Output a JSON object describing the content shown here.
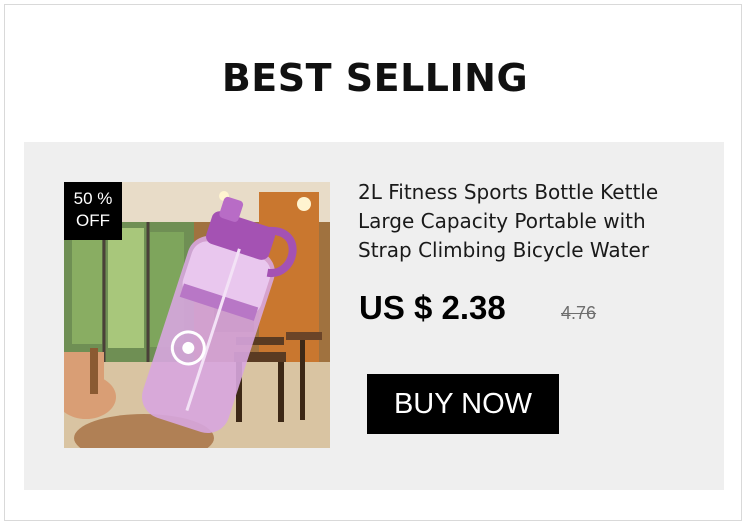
{
  "section": {
    "heading": "BEST SELLING"
  },
  "product": {
    "badge_percent": "50 %",
    "badge_off": "OFF",
    "title": "2L Fitness Sports Bottle Kettle Large Capacity Portable with Strap Climbing Bicycle Water",
    "price": "US $ 2.38",
    "original_price": "4.76",
    "buy_label": "BUY NOW",
    "image_icon": "water-bottle-photo"
  },
  "colors": {
    "card_background": "#efefef",
    "button_background": "#000000",
    "button_text": "#ffffff",
    "badge_background": "#000000",
    "bottle_color": "#c98ad6"
  }
}
